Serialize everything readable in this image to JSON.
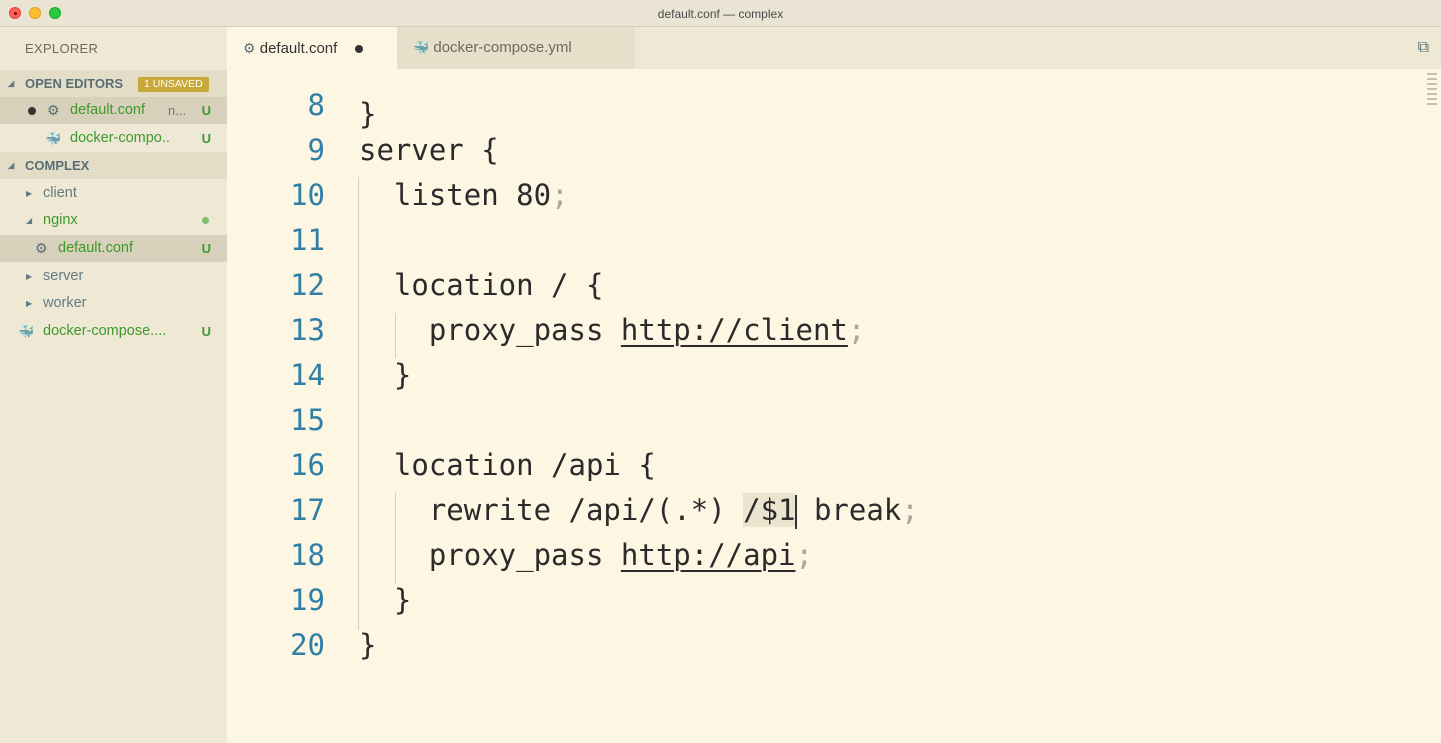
{
  "window": {
    "title": "default.conf — complex"
  },
  "sidebar": {
    "title": "EXPLORER",
    "open_editors": {
      "label": "OPEN EDITORS",
      "badge": "1 UNSAVED",
      "items": [
        {
          "name": "default.conf",
          "hint": "n...",
          "status": "U",
          "icon": "gear-icon",
          "dirty": true
        },
        {
          "name": "docker-compo..",
          "status": "U",
          "icon": "docker-whale-icon"
        }
      ]
    },
    "project": {
      "label": "COMPLEX",
      "tree": [
        {
          "name": "client",
          "type": "folder",
          "expanded": false
        },
        {
          "name": "nginx",
          "type": "folder",
          "expanded": true
        },
        {
          "name": "default.conf",
          "type": "file",
          "status": "U",
          "icon": "gear-icon"
        },
        {
          "name": "server",
          "type": "folder",
          "expanded": false
        },
        {
          "name": "worker",
          "type": "folder",
          "expanded": false
        },
        {
          "name": "docker-compose....",
          "type": "file",
          "status": "U",
          "icon": "docker-whale-icon"
        }
      ]
    }
  },
  "tabs": [
    {
      "label": "default.conf",
      "icon": "gear-icon",
      "active": true,
      "dirty": true
    },
    {
      "label": "docker-compose.yml",
      "icon": "docker-whale-icon",
      "active": false
    }
  ],
  "editor": {
    "lines": [
      {
        "num": "8",
        "code": ""
      },
      {
        "num": "9",
        "code": "server {"
      },
      {
        "num": "10",
        "code": "  listen 80",
        "semi": ";"
      },
      {
        "num": "11",
        "code": ""
      },
      {
        "num": "12",
        "code": "  location / {"
      },
      {
        "num": "13",
        "pre": "    proxy_pass ",
        "url": "http://client",
        "semi": ";"
      },
      {
        "num": "14",
        "code": "  }"
      },
      {
        "num": "15",
        "code": ""
      },
      {
        "num": "16",
        "code": "  location /api {"
      },
      {
        "num": "17",
        "pre": "    rewrite /api/(.*) ",
        "hl": "/$1",
        "post": " break",
        "semi": ";"
      },
      {
        "num": "18",
        "pre": "    proxy_pass ",
        "url": "http://api",
        "semi": ";"
      },
      {
        "num": "19",
        "code": "  }"
      },
      {
        "num": "20",
        "code": "}"
      }
    ]
  },
  "colors": {
    "editor_bg": "#fdf6e3",
    "sidebar_bg": "#eee8d5",
    "line_number": "#2f7fa6",
    "git_untracked": "#3d9a2c"
  }
}
